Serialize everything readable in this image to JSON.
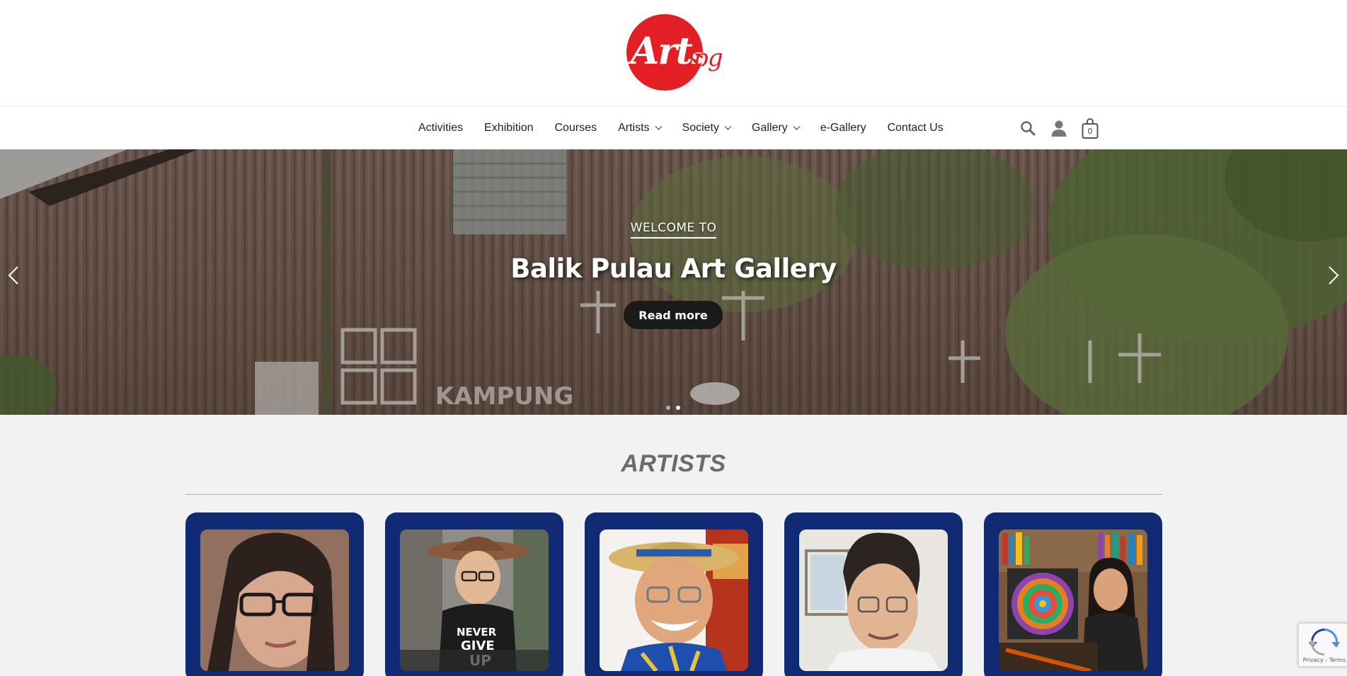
{
  "brand": {
    "logo_main": "Art",
    "logo_sub": "s",
    "logo_suffix": "pg",
    "accent": "#e31e24"
  },
  "nav": {
    "items": [
      {
        "label": "Activities",
        "dropdown": false
      },
      {
        "label": "Exhibition",
        "dropdown": false
      },
      {
        "label": "Courses",
        "dropdown": false
      },
      {
        "label": "Artists",
        "dropdown": true
      },
      {
        "label": "Society",
        "dropdown": true
      },
      {
        "label": "Gallery",
        "dropdown": true
      },
      {
        "label": "e-Gallery",
        "dropdown": false
      },
      {
        "label": "Contact Us",
        "dropdown": false
      }
    ],
    "icons": [
      "search-icon",
      "account-icon",
      "cart-icon"
    ],
    "cart_count": "0"
  },
  "hero": {
    "kicker": "WELCOME TO",
    "title": "Balik Pulau Art Gallery",
    "cta": "Read more",
    "slide_count": 2,
    "active_slide": 2
  },
  "artists": {
    "heading": "ARTISTS",
    "card_color": "#112a74",
    "cards": [
      {
        "photo": "artist-photo-1"
      },
      {
        "photo": "artist-photo-2"
      },
      {
        "photo": "artist-photo-3"
      },
      {
        "photo": "artist-photo-4"
      },
      {
        "photo": "artist-photo-5"
      }
    ]
  },
  "recaptcha": {
    "terms": "Privacy - Terms"
  }
}
